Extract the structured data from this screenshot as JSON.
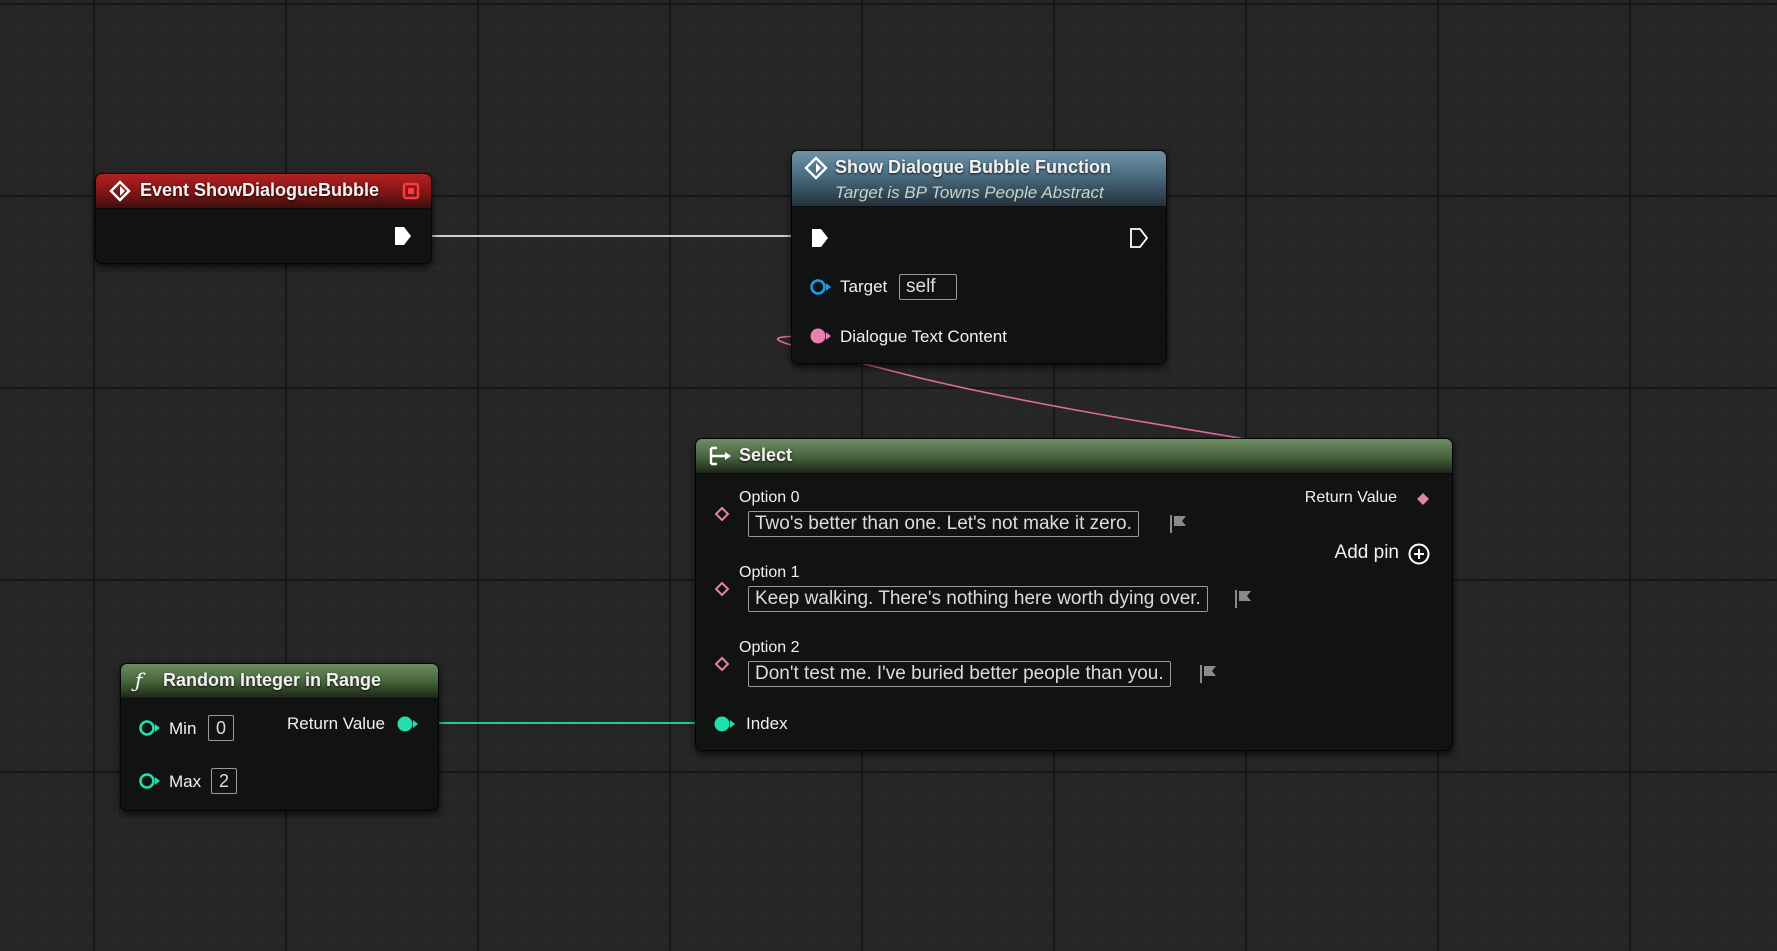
{
  "event_node": {
    "title": "Event ShowDialogueBubble",
    "header_color": "#8b1a1a"
  },
  "function_node": {
    "title": "Show Dialogue Bubble Function",
    "subtitle": "Target is BP Towns People Abstract",
    "header_color": "#4d6f84",
    "target_label": "Target",
    "target_value": "self",
    "text_pin_label": "Dialogue Text Content"
  },
  "select_node": {
    "title": "Select",
    "header_color": "#4f6b45",
    "return_label": "Return Value",
    "add_pin_label": "Add pin",
    "index_label": "Index",
    "options": [
      {
        "label": "Option 0",
        "value": "Two's better than one. Let's not make it zero."
      },
      {
        "label": "Option 1",
        "value": "Keep walking. There's nothing here worth dying over."
      },
      {
        "label": "Option 2",
        "value": "Don't test me. I've buried better people than you."
      }
    ]
  },
  "random_node": {
    "title": "Random Integer in Range",
    "header_color": "#4a6a3c",
    "min_label": "Min",
    "min_value": "0",
    "max_label": "Max",
    "max_value": "2",
    "return_label": "Return Value"
  },
  "colors": {
    "exec_pin": "#ffffff",
    "object_pin": "#1e9be0",
    "text_pin": "#e77fb0",
    "integer_pin": "#1fe0ad",
    "exec_wire": "#cfcfcf",
    "text_wire": "#e06a9e",
    "integer_wire": "#1fc9a0"
  }
}
